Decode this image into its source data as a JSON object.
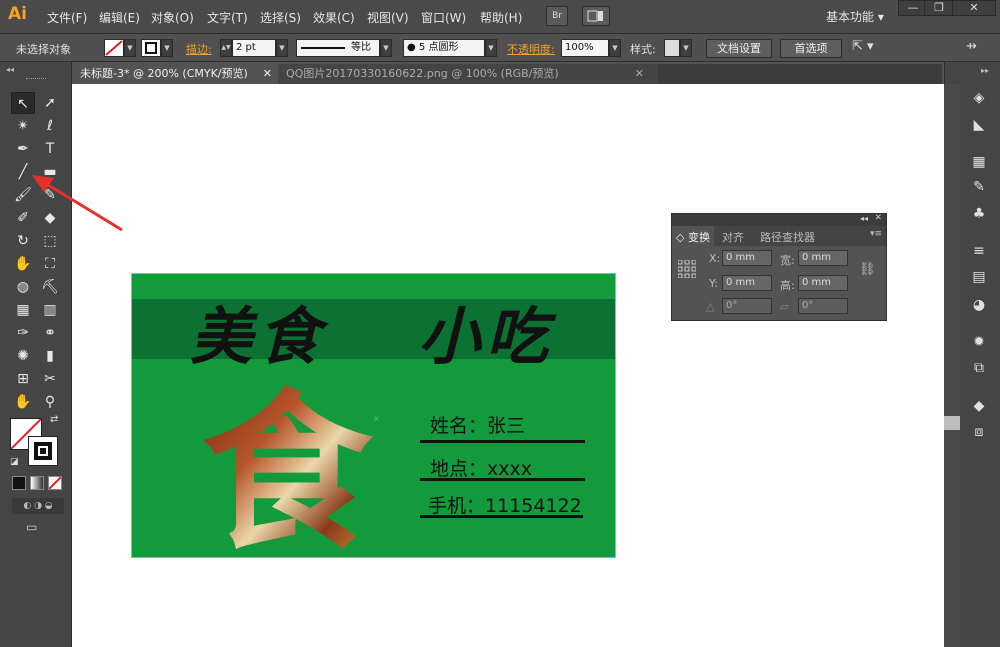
{
  "app": {
    "logo": "Ai",
    "workspace": "基本功能 ▾"
  },
  "menu": [
    "文件(F)",
    "编辑(E)",
    "对象(O)",
    "文字(T)",
    "选择(S)",
    "效果(C)",
    "视图(V)",
    "窗口(W)",
    "帮助(H)"
  ],
  "menubar_buttons": {
    "bridge": "Br"
  },
  "window_controls": {
    "minimize": "—",
    "restore": "❐",
    "close": "✕"
  },
  "control_bar": {
    "selection": "未选择对象",
    "stroke_label": "描边:",
    "stroke_weight": "2 pt",
    "stroke_profile": "等比",
    "brush": "● 5 点圆形",
    "opacity_label": "不透明度:",
    "opacity_value": "100%",
    "style_label": "样式:",
    "doc_setup": "文档设置",
    "preferences": "首选项"
  },
  "tabs": [
    {
      "label": "未标题-3* @ 200% (CMYK/预览)",
      "close": "✕"
    },
    {
      "label": "QQ图片20170330160622.png @ 100% (RGB/预览)",
      "close": "✕"
    }
  ],
  "card": {
    "title_left": "美食",
    "title_right": "小吃",
    "big_char": "食",
    "name": "姓名：张三",
    "place": "地点：xxxx",
    "phone": "手机：11154122",
    "bg_color": "#129a3c",
    "band_color": "#0b7233"
  },
  "transform_panel": {
    "tabs": [
      "变换",
      "对齐",
      "路径查找器"
    ],
    "x_label": "X:",
    "x_value": "0 mm",
    "y_label": "Y:",
    "y_value": "0 mm",
    "w_label": "宽:",
    "w_value": "0 mm",
    "h_label": "高:",
    "h_value": "0 mm",
    "angle1": "0°",
    "angle2": "0°"
  }
}
